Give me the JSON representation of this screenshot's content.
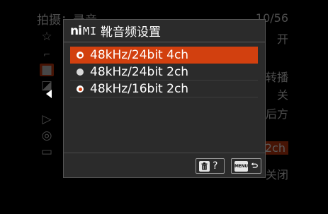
{
  "background_menu": {
    "title": "拍摄：录音",
    "page": "10/56",
    "values": [
      "开",
      "转播",
      "关",
      "后方",
      "2ch",
      "关闭"
    ]
  },
  "dialog": {
    "title_icon_text": "ni",
    "title_icon_sub": "MI",
    "title": "靴音频设置",
    "options": [
      {
        "label": "48kHz/24bit 4ch",
        "selected": true
      },
      {
        "label": "48kHz/24bit 2ch",
        "selected": false
      },
      {
        "label": "48kHz/16bit 2ch",
        "selected": false
      }
    ],
    "footer": {
      "delete_key_icon": "trash-icon",
      "help_label": "?",
      "menu_key_label": "MENU",
      "back_icon": "back-arrow-icon"
    }
  },
  "colors": {
    "selection": "#d2400f",
    "dialog_bg": "#2b2b2b",
    "page_bg": "#000000"
  }
}
